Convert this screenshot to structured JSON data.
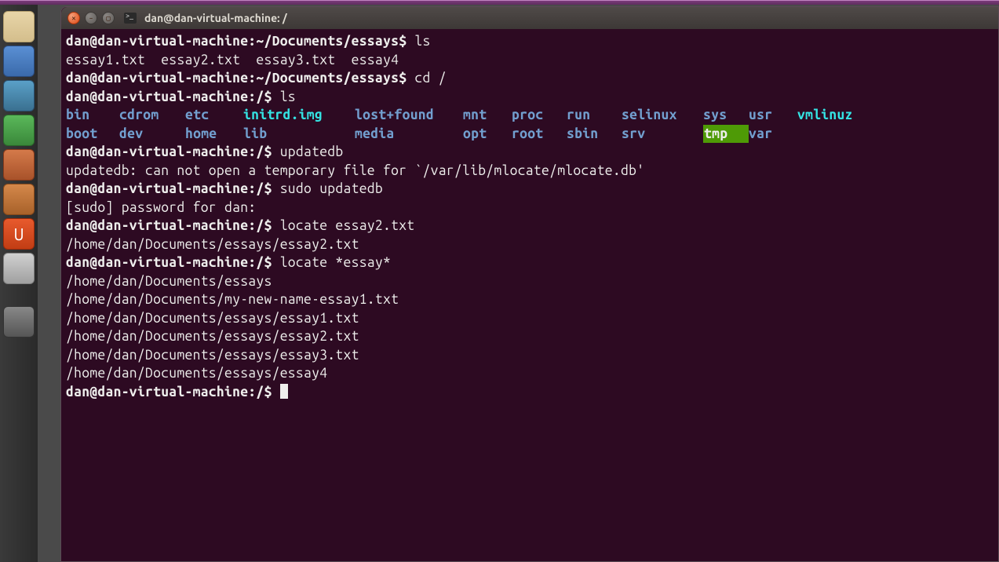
{
  "window": {
    "title": "dan@dan-virtual-machine: /"
  },
  "launcher": {
    "items": [
      {
        "name": "files-icon",
        "glyph": "🏠"
      },
      {
        "name": "firefox-icon",
        "glyph": "🦊"
      },
      {
        "name": "writer-icon",
        "glyph": "📄"
      },
      {
        "name": "calc-icon",
        "glyph": "📊"
      },
      {
        "name": "impress-icon",
        "glyph": "📑"
      },
      {
        "name": "software-icon",
        "glyph": "🛍"
      },
      {
        "name": "ubuntu-icon",
        "glyph": "U"
      },
      {
        "name": "settings-icon",
        "glyph": "🔧"
      },
      {
        "name": "trash-icon",
        "glyph": "🗑"
      }
    ]
  },
  "terminal": {
    "lines": [
      {
        "type": "promptcmd",
        "prompt": "dan@dan-virtual-machine:~/Documents/essays$",
        "cmd": " ls"
      },
      {
        "type": "plain",
        "text": "essay1.txt  essay2.txt  essay3.txt  essay4"
      },
      {
        "type": "promptcmd",
        "prompt": "dan@dan-virtual-machine:~/Documents/essays$",
        "cmd": " cd /"
      },
      {
        "type": "promptcmd",
        "prompt": "dan@dan-virtual-machine:/$",
        "cmd": " ls"
      },
      {
        "type": "ls-row",
        "cells": [
          {
            "t": "bin",
            "c": "dir-blue"
          },
          {
            "t": "cdrom",
            "c": "dir-blue"
          },
          {
            "t": "etc",
            "c": "dir-blue"
          },
          {
            "t": "initrd.img",
            "c": "link-cyan"
          },
          {
            "t": "lost+found",
            "c": "dir-blue"
          },
          {
            "t": "mnt",
            "c": "dir-blue"
          },
          {
            "t": "proc",
            "c": "dir-blue"
          },
          {
            "t": "run",
            "c": "dir-blue"
          },
          {
            "t": "selinux",
            "c": "dir-blue"
          },
          {
            "t": "sys",
            "c": "dir-blue"
          },
          {
            "t": "usr",
            "c": "dir-blue"
          },
          {
            "t": "vmlinuz",
            "c": "link-cyan"
          }
        ]
      },
      {
        "type": "ls-row",
        "cells": [
          {
            "t": "boot",
            "c": "dir-blue"
          },
          {
            "t": "dev",
            "c": "dir-blue"
          },
          {
            "t": "home",
            "c": "dir-blue"
          },
          {
            "t": "lib",
            "c": "dir-blue"
          },
          {
            "t": "media",
            "c": "dir-blue"
          },
          {
            "t": "opt",
            "c": "dir-blue"
          },
          {
            "t": "root",
            "c": "dir-blue"
          },
          {
            "t": "sbin",
            "c": "dir-blue"
          },
          {
            "t": "srv",
            "c": "dir-blue"
          },
          {
            "t": "tmp",
            "c": "hl-green"
          },
          {
            "t": "var",
            "c": "dir-blue"
          },
          {
            "t": "",
            "c": ""
          }
        ]
      },
      {
        "type": "promptcmd",
        "prompt": "dan@dan-virtual-machine:/$",
        "cmd": " updatedb"
      },
      {
        "type": "plain",
        "text": "updatedb: can not open a temporary file for `/var/lib/mlocate/mlocate.db'"
      },
      {
        "type": "promptcmd",
        "prompt": "dan@dan-virtual-machine:/$",
        "cmd": " sudo updatedb"
      },
      {
        "type": "plain",
        "text": "[sudo] password for dan:"
      },
      {
        "type": "promptcmd",
        "prompt": "dan@dan-virtual-machine:/$",
        "cmd": " locate essay2.txt"
      },
      {
        "type": "plain",
        "text": "/home/dan/Documents/essays/essay2.txt"
      },
      {
        "type": "promptcmd",
        "prompt": "dan@dan-virtual-machine:/$",
        "cmd": " locate *essay*"
      },
      {
        "type": "plain",
        "text": "/home/dan/Documents/essays"
      },
      {
        "type": "plain",
        "text": "/home/dan/Documents/my-new-name-essay1.txt"
      },
      {
        "type": "plain",
        "text": "/home/dan/Documents/essays/essay1.txt"
      },
      {
        "type": "plain",
        "text": "/home/dan/Documents/essays/essay2.txt"
      },
      {
        "type": "plain",
        "text": "/home/dan/Documents/essays/essay3.txt"
      },
      {
        "type": "plain",
        "text": "/home/dan/Documents/essays/essay4"
      },
      {
        "type": "promptcursor",
        "prompt": "dan@dan-virtual-machine:/$",
        "cmd": " "
      }
    ]
  }
}
